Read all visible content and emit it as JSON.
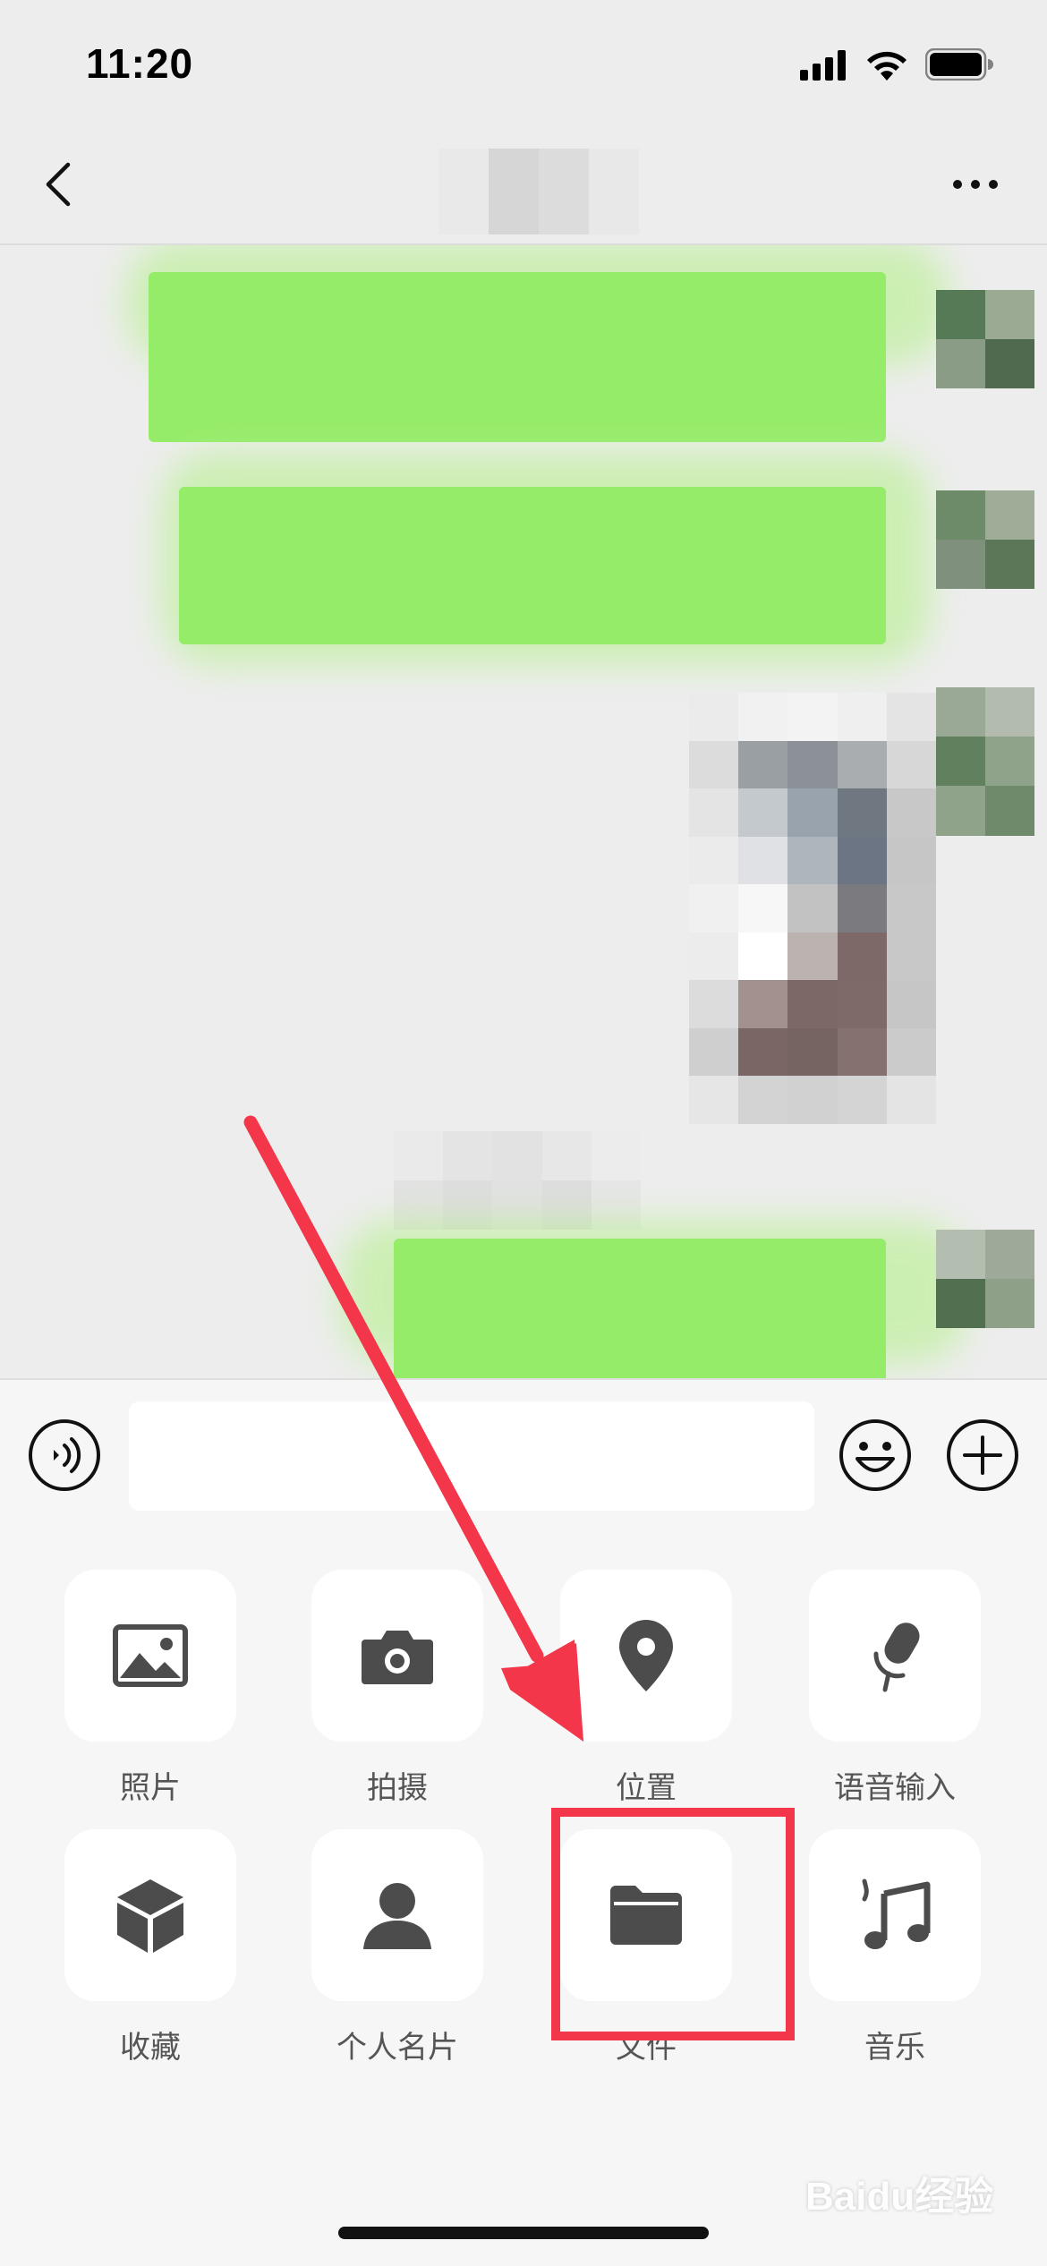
{
  "status_bar": {
    "time": "11:20"
  },
  "input_bar": {
    "placeholder": ""
  },
  "actions": [
    {
      "label": "照片",
      "icon": "photo-icon"
    },
    {
      "label": "拍摄",
      "icon": "camera-icon"
    },
    {
      "label": "位置",
      "icon": "location-pin-icon"
    },
    {
      "label": "语音输入",
      "icon": "microphone-icon"
    },
    {
      "label": "收藏",
      "icon": "favorites-cube-icon"
    },
    {
      "label": "个人名片",
      "icon": "contact-card-icon"
    },
    {
      "label": "文件",
      "icon": "folder-icon"
    },
    {
      "label": "音乐",
      "icon": "music-note-icon"
    }
  ],
  "watermark": "Baidu经验",
  "colors": {
    "bubble": "#95ec69",
    "annotation": "#f3364a",
    "icon": "#4c4c4c",
    "background": "#ededed",
    "panel": "#f6f6f6"
  }
}
